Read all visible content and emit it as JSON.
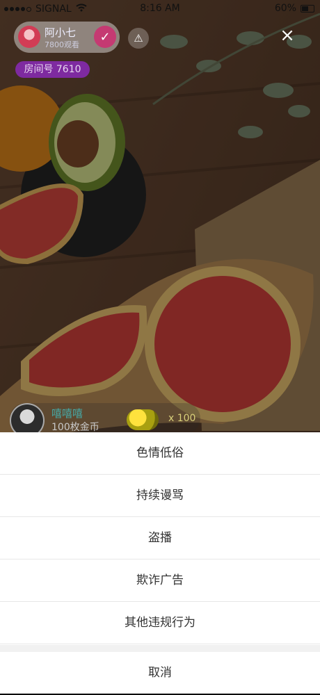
{
  "status_bar": {
    "carrier": "SIGNAL",
    "time": "8:16 AM",
    "battery": "60%"
  },
  "host": {
    "name": "阿小七",
    "viewers": "7800观看"
  },
  "room": {
    "label": "房间号 7610"
  },
  "gift_feed": {
    "user": "嘻嘻嘻",
    "message": "100枚金币",
    "count": "x 100"
  },
  "report_sheet": {
    "options": [
      "色情低俗",
      "持续谩骂",
      "盗播",
      "欺诈广告",
      "其他违规行为"
    ],
    "cancel": "取消"
  },
  "icons": [
    "wifi-icon",
    "battery-icon",
    "check-icon",
    "warning-icon",
    "close-icon",
    "coin-icon"
  ],
  "colors": {
    "accent": "#c53a72",
    "room_badge": "#7e2aa0",
    "gift_user": "#46a9a6"
  }
}
